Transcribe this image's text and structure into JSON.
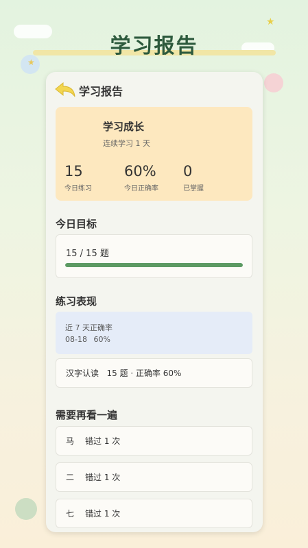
{
  "page_title": "学习报告",
  "card": {
    "title": "学习报告",
    "growth": {
      "title": "学习成长",
      "streak": "连续学习 1 天",
      "stats": [
        {
          "value": "15",
          "label": "今日练习"
        },
        {
          "value": "60%",
          "label": "今日正确率"
        },
        {
          "value": "0",
          "label": "已掌握"
        }
      ]
    },
    "goal": {
      "section_title": "今日目标",
      "text": "15 / 15 题",
      "progress": 1.0
    },
    "performance": {
      "section_title": "练习表现",
      "trend_title": "近 7 天正确率",
      "trend_date": "08-18",
      "trend_value": "60%",
      "summary": "汉字认读   15 题 · 正确率 60%"
    },
    "review": {
      "section_title": "需要再看一遍",
      "items": [
        {
          "char": "马",
          "text": "错过 1 次"
        },
        {
          "char": "二",
          "text": "错过 1 次"
        },
        {
          "char": "七",
          "text": "错过 1 次"
        }
      ]
    }
  },
  "colors": {
    "accent_green": "#5c9a63",
    "title_green": "#2d5a3d",
    "growth_bg": "#fde8bf",
    "trend_bg": "#e5ecf8"
  },
  "icons": {
    "back": "back-arrow-icon"
  }
}
